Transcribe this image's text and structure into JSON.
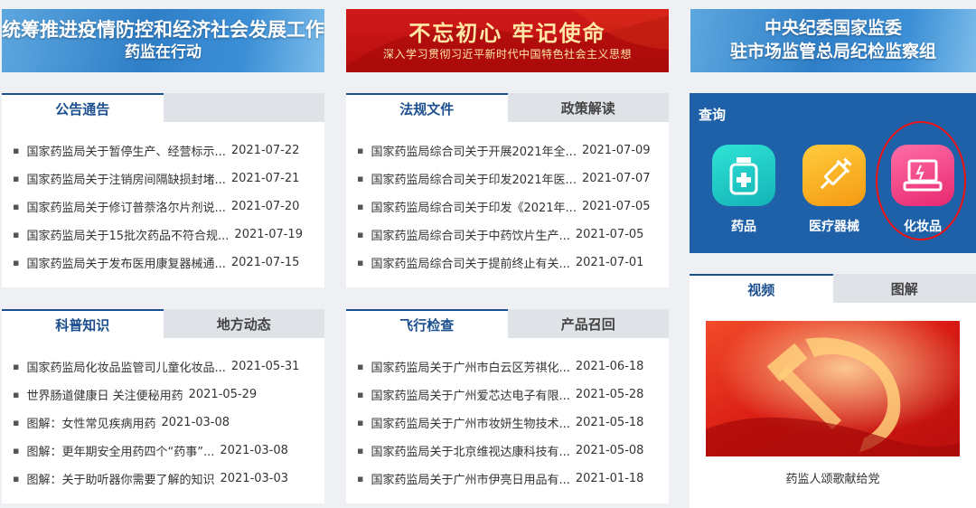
{
  "banners": {
    "b1": {
      "line1": "统筹推进疫情防控和经济社会发展工作",
      "line2": "药监在行动"
    },
    "b2": {
      "line1": "不忘初心 牢记使命",
      "line2": "深入学习贯彻习近平新时代中国特色社会主义思想"
    },
    "b3": {
      "line1": "中央纪委国家监委",
      "line2": "驻市场监管总局纪检监察组"
    }
  },
  "panel1": {
    "tabs": [
      "公告通告",
      ""
    ],
    "items": [
      {
        "title": "国家药监局关于暂停生产、经营标示...",
        "date": "2021-07-22"
      },
      {
        "title": "国家药监局关于注销房间隔缺损封堵...",
        "date": "2021-07-21"
      },
      {
        "title": "国家药监局关于修订普萘洛尔片剂说...",
        "date": "2021-07-20"
      },
      {
        "title": "国家药监局关于15批次药品不符合规...",
        "date": "2021-07-19"
      },
      {
        "title": "国家药监局关于发布医用康复器械通...",
        "date": "2021-07-15"
      }
    ]
  },
  "panel2": {
    "tabs": [
      "法规文件",
      "政策解读"
    ],
    "items": [
      {
        "title": "国家药监局综合司关于开展2021年全...",
        "date": "2021-07-09"
      },
      {
        "title": "国家药监局综合司关于印发2021年医...",
        "date": "2021-07-07"
      },
      {
        "title": "国家药监局综合司关于印发《2021年...",
        "date": "2021-07-05"
      },
      {
        "title": "国家药监局综合司关于中药饮片生产...",
        "date": "2021-07-05"
      },
      {
        "title": "国家药监局综合司关于提前终止有关...",
        "date": "2021-07-01"
      }
    ]
  },
  "panel3": {
    "tabs": [
      "科普知识",
      "地方动态"
    ],
    "items": [
      {
        "title": "国家药监局化妆品监管司儿童化妆品...",
        "date": "2021-05-31"
      },
      {
        "title": "世界肠道健康日 关注便秘用药",
        "date": "2021-05-29"
      },
      {
        "title": "图解：女性常见疾病用药",
        "date": "2021-03-08"
      },
      {
        "title": "图解：更年期安全用药四个“药事”...",
        "date": "2021-03-08"
      },
      {
        "title": "图解：关于助听器你需要了解的知识",
        "date": "2021-03-03"
      }
    ]
  },
  "panel4": {
    "tabs": [
      "飞行检查",
      "产品召回"
    ],
    "items": [
      {
        "title": "国家药监局关于广州市白云区芳祺化...",
        "date": "2021-06-18"
      },
      {
        "title": "国家药监局关于广州爱芯达电子有限...",
        "date": "2021-05-28"
      },
      {
        "title": "国家药监局关于广州市妆妍生物技术...",
        "date": "2021-05-18"
      },
      {
        "title": "国家药监局关于北京维视达康科技有...",
        "date": "2021-05-08"
      },
      {
        "title": "国家药监局关于广州市伊亮日用品有...",
        "date": "2021-01-18"
      }
    ]
  },
  "query": {
    "title": "查询",
    "items": [
      {
        "label": "药品",
        "icon": "medicine-bottle-icon"
      },
      {
        "label": "医疗器械",
        "icon": "syringe-icon"
      },
      {
        "label": "化妆品",
        "icon": "cosmetics-case-icon"
      }
    ]
  },
  "video": {
    "tabs": [
      "视频",
      "图解"
    ],
    "caption": "药监人颂歌献给党"
  },
  "colors": {
    "primary_blue": "#1e61a9",
    "tab_active_text": "#1c4f8f",
    "banner_red": "#c41414",
    "highlight_ring": "#ee1111"
  }
}
